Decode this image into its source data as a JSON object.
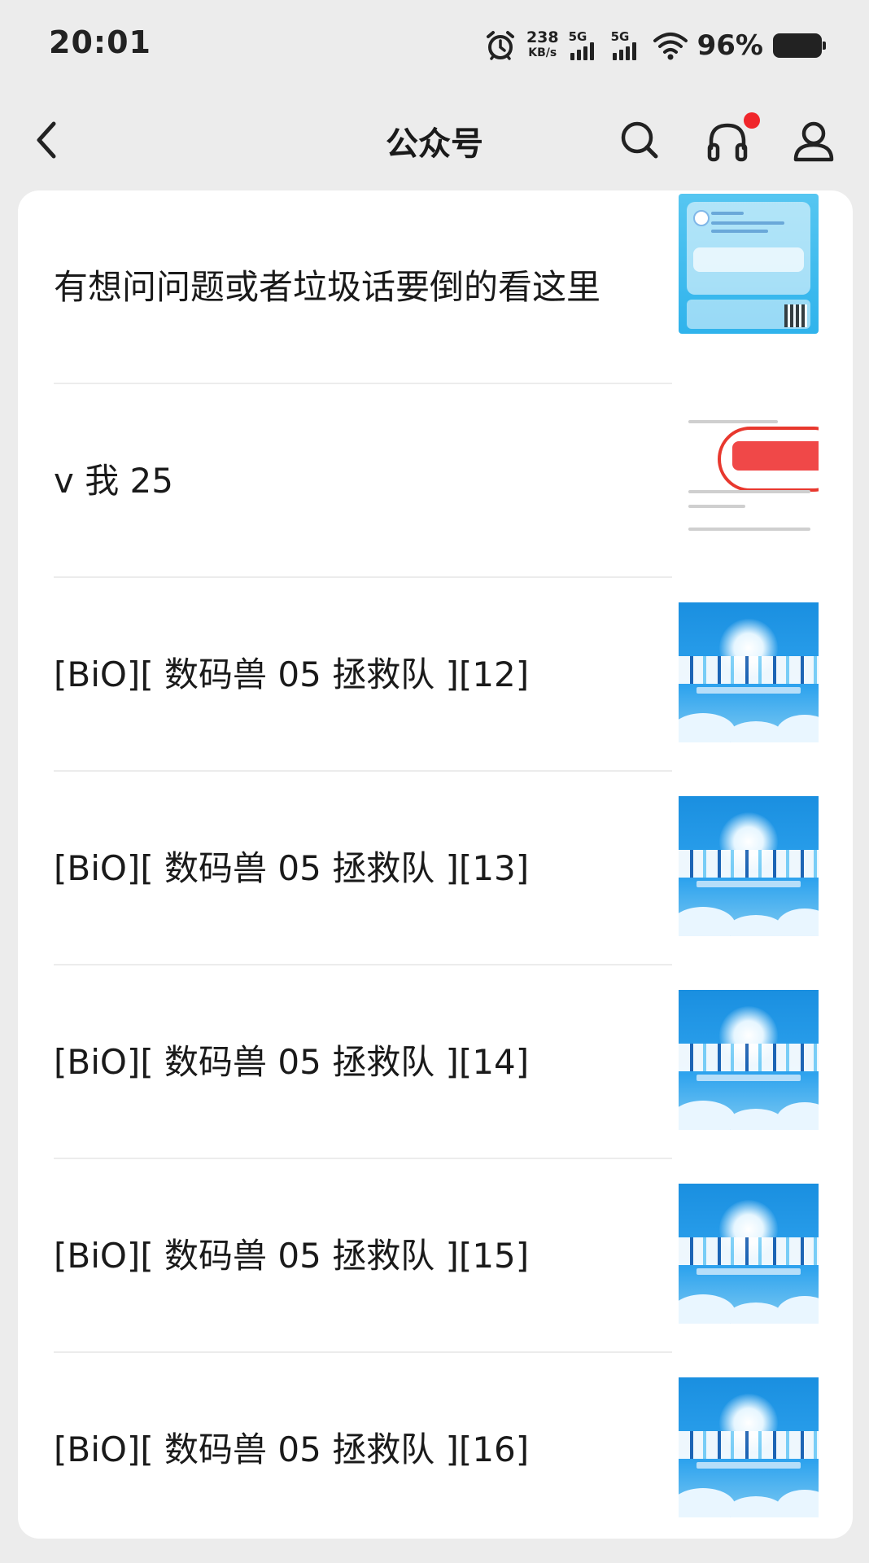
{
  "status_bar": {
    "time": "20:01",
    "net_speed_value": "238",
    "net_speed_unit": "KB/s",
    "sim1_label": "5G",
    "sim2_label": "5G",
    "battery_percent": "96%"
  },
  "nav": {
    "title": "公众号",
    "has_notification_dot": true,
    "accent_color": "#f0262b"
  },
  "articles": [
    {
      "title": "有想问问题或者垃圾话要倒的看这里",
      "thumbnail": "qa-poster"
    },
    {
      "title": "v 我 25",
      "thumbnail": "app-screenshot"
    },
    {
      "title": "[BiO][ 数码兽 05 拯救队 ][12]",
      "thumbnail": "digimon-savers-logo"
    },
    {
      "title": "[BiO][ 数码兽 05 拯救队 ][13]",
      "thumbnail": "digimon-savers-logo"
    },
    {
      "title": "[BiO][ 数码兽 05 拯救队 ][14]",
      "thumbnail": "digimon-savers-logo"
    },
    {
      "title": "[BiO][ 数码兽 05 拯救队 ][15]",
      "thumbnail": "digimon-savers-logo"
    },
    {
      "title": "[BiO][ 数码兽 05 拯救队 ][16]",
      "thumbnail": "digimon-savers-logo"
    }
  ]
}
